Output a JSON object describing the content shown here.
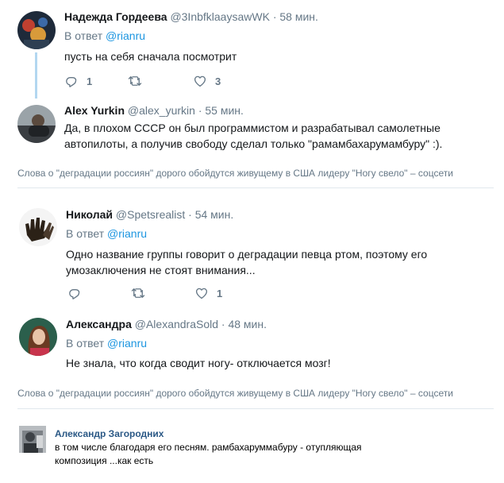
{
  "tweets": [
    {
      "name": "Надежда Гордеева",
      "handle": "@3InbfklaaysawWK",
      "time": "· 58 мин.",
      "reply_prefix": "В ответ",
      "reply_to": "@rianru",
      "text": "пусть на себя сначала посмотрит",
      "replies": "1",
      "retweets": "",
      "likes": "3"
    },
    {
      "name": "Alex Yurkin",
      "handle": "@alex_yurkin",
      "time": "· 55 мин.",
      "text_line1": "Да, в плохом СССР он был программистом и разрабатывал самолетные",
      "text_line2": "автопилоты, а получив свободу сделал только \"рамамбахарумамбуру\" :)."
    },
    {
      "name": "Николай",
      "handle": "@Spetsrealist",
      "time": "· 54 мин.",
      "reply_prefix": "В ответ",
      "reply_to": "@rianru",
      "text_line1": "Одно название группы говорит о деградации певца ртом, поэтому его",
      "text_line2": "умозаключения не стоят внимания...",
      "replies": "",
      "retweets": "",
      "likes": "1"
    },
    {
      "name": "Александра",
      "handle": "@AlexandraSold",
      "time": "· 48 мин.",
      "reply_prefix": "В ответ",
      "reply_to": "@rianru",
      "text": "Не знала, что когда сводит ногу- отключается мозг!"
    }
  ],
  "article_link": "Слова о \"деградации россиян\" дорого обойдутся живущему в США лидеру \"Ногу свело\" – соцсети",
  "vk_comment": {
    "name": "Александр Загородних",
    "text_line1": "в том числе благодаря его песням. рамбахаруммабуру - отупляющая",
    "text_line2": "композиция ...как есть"
  },
  "icons": {
    "reply": "reply-icon",
    "retweet": "retweet-icon",
    "like": "heart-icon"
  },
  "colors": {
    "link": "#1b95e0",
    "muted": "#657786",
    "thread": "#b3d7f0",
    "vk_name": "#2a5885"
  }
}
